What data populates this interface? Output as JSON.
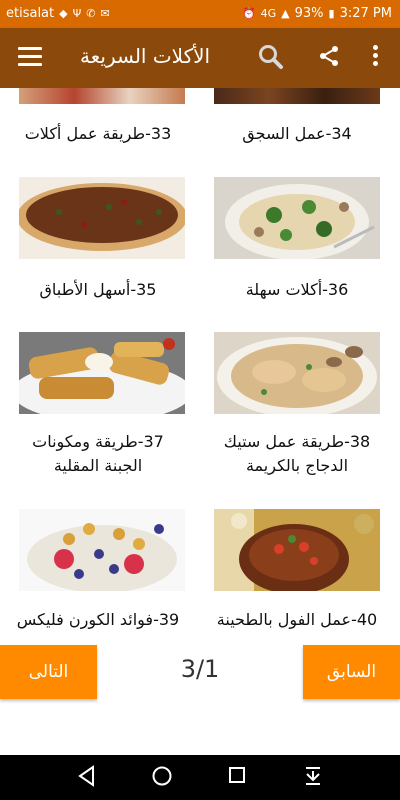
{
  "status_bar": {
    "carrier": "etisalat",
    "battery": "93%",
    "time": "3:27 PM",
    "network": "4G"
  },
  "app_bar": {
    "title": "الأكلات السريعة",
    "icons": [
      "menu-icon",
      "search-icon",
      "share-icon",
      "more-icon"
    ]
  },
  "items": [
    {
      "label": "34-عمل السجق"
    },
    {
      "label": "33-طريقة عمل أكلات"
    },
    {
      "label": "36-أكلات سهلة"
    },
    {
      "label": "35-أسهل الأطباق"
    },
    {
      "label_line1": "38-طريقة عمل ستيك",
      "label_line2": "الدجاج بالكريمة"
    },
    {
      "label_line1": "37-طريقة ومكونات",
      "label_line2": "الجبنة المقلية"
    },
    {
      "label": "40-عمل الفول بالطحينة"
    },
    {
      "label": "39-فوائد الكورن فليكس"
    }
  ],
  "pagination": {
    "next_label": "التالى",
    "prev_label": "السابق",
    "page": "3/1"
  },
  "colors": {
    "status_bar": "#d86a00",
    "app_bar": "#8b4a0c",
    "accent": "#ff8a00"
  }
}
